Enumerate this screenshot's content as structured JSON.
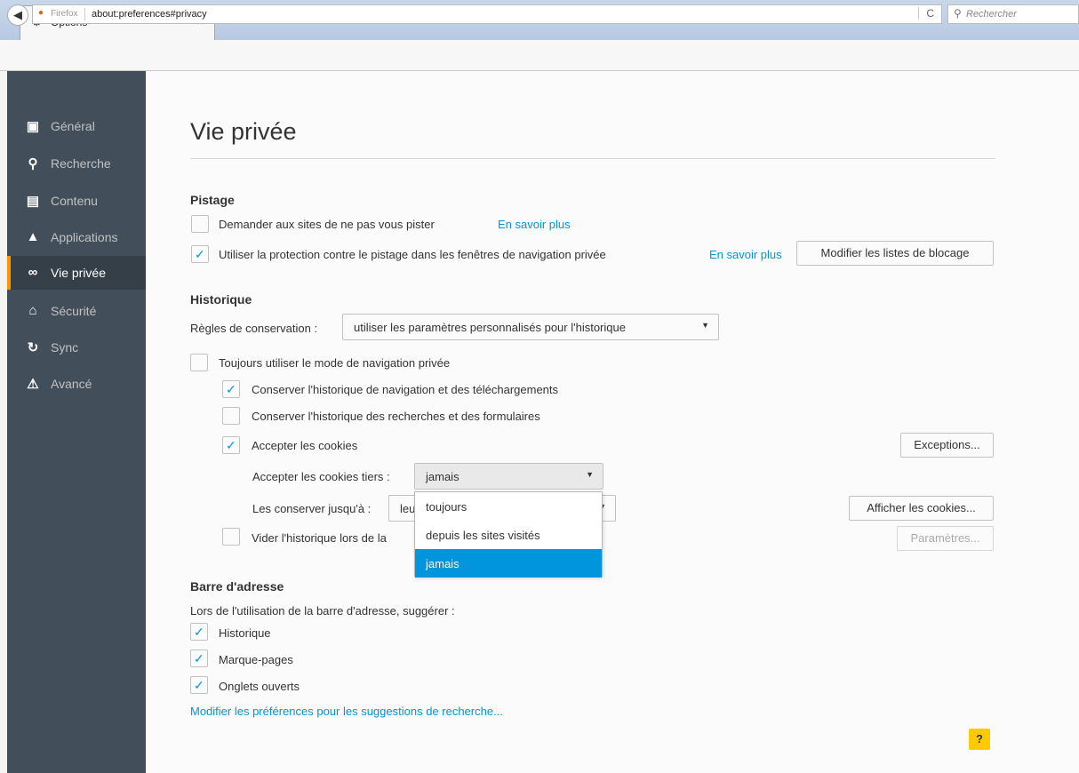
{
  "browser": {
    "tab_title": "Options",
    "tab_close": "×",
    "new_tab": "+",
    "identity_label": "Firefox",
    "url": "about:preferences#privacy",
    "reload": "C",
    "search_placeholder": "Rechercher"
  },
  "sidebar": {
    "items": [
      {
        "label": "Général",
        "icon": "general-icon",
        "glyph": "▣"
      },
      {
        "label": "Recherche",
        "icon": "search-icon",
        "glyph": "⚲"
      },
      {
        "label": "Contenu",
        "icon": "content-icon",
        "glyph": "▤"
      },
      {
        "label": "Applications",
        "icon": "applications-icon",
        "glyph": "▲"
      },
      {
        "label": "Vie privée",
        "icon": "privacy-mask-icon",
        "glyph": "∞"
      },
      {
        "label": "Sécurité",
        "icon": "security-lock-icon",
        "glyph": "⌂"
      },
      {
        "label": "Sync",
        "icon": "sync-icon",
        "glyph": "↻"
      },
      {
        "label": "Avancé",
        "icon": "advanced-icon",
        "glyph": "⚠"
      }
    ],
    "active": "Vie privée"
  },
  "page": {
    "title": "Vie privée",
    "tracking": {
      "heading": "Pistage",
      "dnt_label": "Demander aux sites de ne pas vous pister",
      "dnt_checked": false,
      "dnt_link": "En savoir plus",
      "tp_label": "Utiliser la protection contre le pistage dans les fenêtres de navigation privée",
      "tp_checked": true,
      "tp_link": "En savoir plus",
      "blocklist_button": "Modifier les listes de blocage"
    },
    "history": {
      "heading": "Historique",
      "rules_label": "Règles de conservation :",
      "rules_value": "utiliser les paramètres personnalisés pour l'historique",
      "always_private_label": "Toujours utiliser le mode de navigation privée",
      "keep_browsing_label": "Conserver l'historique de navigation et des téléchargements",
      "keep_search_label": "Conserver l'historique des recherches et des formulaires",
      "accept_cookies_label": "Accepter les cookies",
      "exceptions_button": "Exceptions...",
      "third_party_label": "Accepter les cookies tiers :",
      "third_party_value": "jamais",
      "keep_until_label": "Les conserver jusqu'à :",
      "keep_until_value": "leu",
      "show_cookies_button": "Afficher les cookies...",
      "clear_history_label": "Vider l'historique lors de la",
      "settings_button": "Paramètres...",
      "dropdown_options": [
        "toujours",
        "depuis les sites visités",
        "jamais"
      ],
      "dropdown_selected": "jamais"
    },
    "addressbar": {
      "heading": "Barre d'adresse",
      "intro": "Lors de l'utilisation de la barre d'adresse, suggérer :",
      "history_label": "Historique",
      "bookmarks_label": "Marque-pages",
      "tabs_label": "Onglets ouverts",
      "search_prefs_link": "Modifier les préférences pour les suggestions de recherche..."
    },
    "help_label": "?"
  },
  "colors": {
    "sidebar_bg": "#424f5a",
    "sidebar_active": "#343f48",
    "accent": "#0095dd",
    "active_marker": "#ff9500",
    "help": "#ffcb00"
  }
}
